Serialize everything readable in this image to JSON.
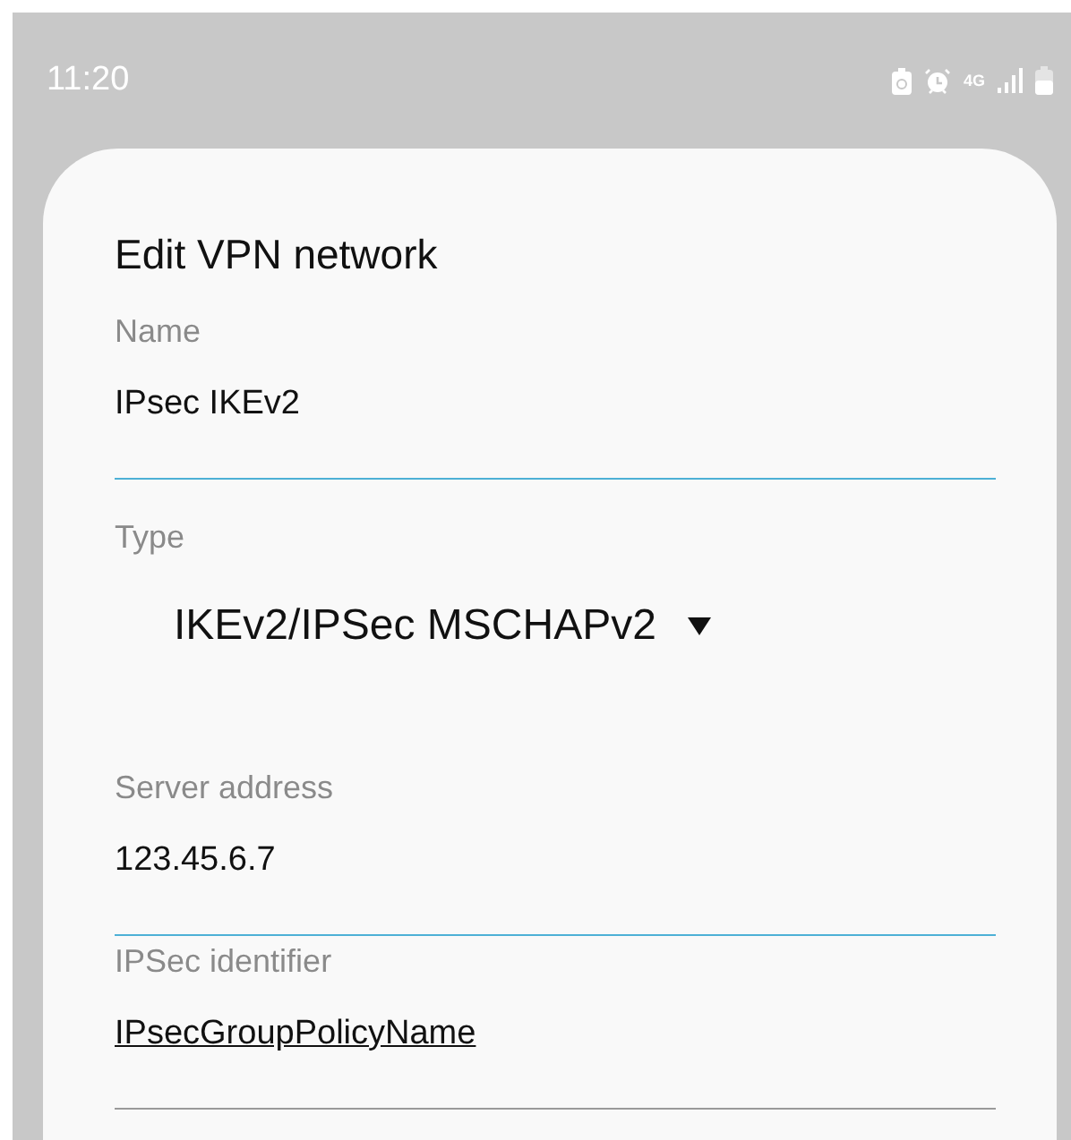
{
  "status_bar": {
    "time": "11:20",
    "network": "4G"
  },
  "dialog": {
    "title": "Edit VPN network",
    "fields": [
      {
        "kind": "text",
        "label": "Name",
        "value": "IPsec IKEv2",
        "highlighted": true,
        "underlined": false
      },
      {
        "kind": "dropdown",
        "label": "Type",
        "value": "IKEv2/IPSec MSCHAPv2"
      },
      {
        "kind": "text",
        "label": "Server address",
        "value": "123.45.6.7",
        "highlighted": true,
        "underlined": false
      },
      {
        "kind": "text",
        "label": "IPSec identifier",
        "value": "IPsecGroupPolicyName",
        "highlighted": false,
        "underlined": true
      }
    ]
  }
}
